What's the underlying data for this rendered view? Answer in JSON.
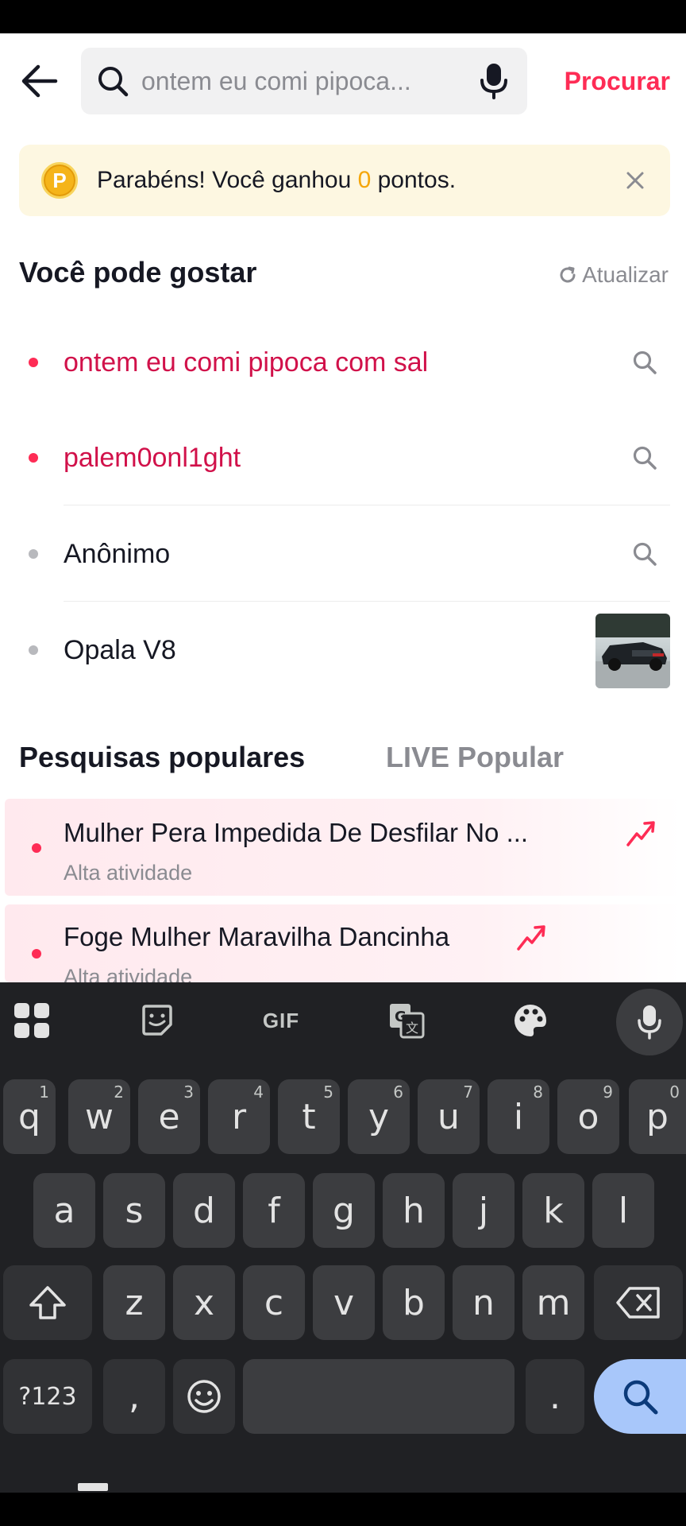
{
  "header": {
    "search_value": "ontem eu comi pipoca...",
    "search_button": "Procurar"
  },
  "banner": {
    "coin_letter": "P",
    "text_before": "Parabéns! Você ganhou ",
    "points": "0",
    "text_after": " pontos."
  },
  "suggestions_section": {
    "title": "Você pode gostar",
    "refresh_label": "Atualizar",
    "items": [
      {
        "label": "ontem eu comi pipoca com sal",
        "highlighted": true
      },
      {
        "label": "palem0onl1ght",
        "highlighted": true
      },
      {
        "label": "Anônimo",
        "highlighted": false
      },
      {
        "label": "Opala V8",
        "highlighted": false
      }
    ]
  },
  "tabs": {
    "popular": "Pesquisas populares",
    "live": "LIVE Popular"
  },
  "trending": [
    {
      "title": "Mulher Pera Impedida De Desfilar No ...",
      "subtitle": "Alta atividade"
    },
    {
      "title": "Foge Mulher Maravilha Dancinha",
      "subtitle": "Alta atividade"
    }
  ],
  "keyboard": {
    "toolbar": [
      "apps-grid-icon",
      "sticker-icon",
      "GIF",
      "translate-icon",
      "palette-icon",
      "mic-icon"
    ],
    "row1": [
      {
        "k": "q",
        "h": "1"
      },
      {
        "k": "w",
        "h": "2"
      },
      {
        "k": "e",
        "h": "3"
      },
      {
        "k": "r",
        "h": "4"
      },
      {
        "k": "t",
        "h": "5"
      },
      {
        "k": "y",
        "h": "6"
      },
      {
        "k": "u",
        "h": "7"
      },
      {
        "k": "i",
        "h": "8"
      },
      {
        "k": "o",
        "h": "9"
      },
      {
        "k": "p",
        "h": "0"
      }
    ],
    "row2": [
      "a",
      "s",
      "d",
      "f",
      "g",
      "h",
      "j",
      "k",
      "l"
    ],
    "row3": [
      "z",
      "x",
      "c",
      "v",
      "b",
      "n",
      "m"
    ],
    "symbols_key": "?123",
    "comma_key": ",",
    "period_key": "."
  },
  "colors": {
    "accent": "#fe2c55",
    "highlight_text": "#d1114a",
    "points": "#f5a60a"
  }
}
